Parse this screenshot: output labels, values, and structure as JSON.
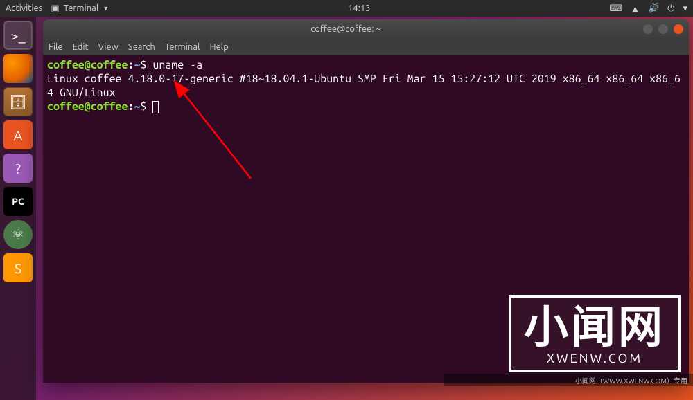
{
  "topbar": {
    "activities": "Activities",
    "app_label": "Terminal",
    "time": "14:13",
    "icons": {
      "keyboard": "⌨",
      "network": "▲",
      "volume": "🔊",
      "power": "⏻",
      "dropdown": "▾"
    }
  },
  "launcher": {
    "items": [
      {
        "name": "terminal",
        "active": true
      },
      {
        "name": "firefox"
      },
      {
        "name": "files"
      },
      {
        "name": "software"
      },
      {
        "name": "help"
      },
      {
        "name": "pycharm",
        "label": "PC"
      },
      {
        "name": "atom"
      },
      {
        "name": "sublime"
      }
    ]
  },
  "terminal": {
    "title": "coffee@coffee: ~",
    "menu": [
      "File",
      "Edit",
      "View",
      "Search",
      "Terminal",
      "Help"
    ],
    "prompt": {
      "user_host": "coffee@coffee",
      "sep": ":",
      "path": "~",
      "symbol": "$"
    },
    "command": "uname -a",
    "output": "Linux coffee 4.18.0-17-generic #18~18.04.1-Ubuntu SMP Fri Mar 15 15:27:12 UTC 2019 x86_64 x86_64 x86_64 GNU/Linux"
  },
  "watermark": {
    "cn": "小闻网",
    "en": "XWENW.COM",
    "strip": "小闻网（WWW.XWENW.COM）专用"
  }
}
